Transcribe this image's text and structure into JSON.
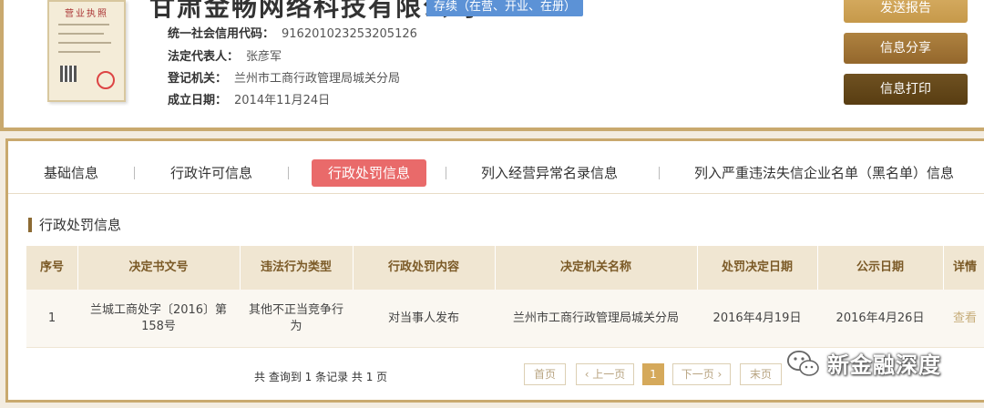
{
  "company": {
    "name": "甘肃金畅网络科技有限公司",
    "status": "存续（在营、开业、在册）",
    "license_title": "营业执照",
    "fields": [
      {
        "label": "统一社会信用代码：",
        "value": "916201023253205126"
      },
      {
        "label": "法定代表人：",
        "value": "张彦军"
      },
      {
        "label": "登记机关：",
        "value": "兰州市工商行政管理局城关分局"
      },
      {
        "label": "成立日期：",
        "value": "2014年11月24日"
      }
    ]
  },
  "actions": {
    "report": "发送报告",
    "share": "信息分享",
    "print": "信息打印"
  },
  "tabs": [
    {
      "label": "基础信息",
      "active": false
    },
    {
      "label": "行政许可信息",
      "active": false
    },
    {
      "label": "行政处罚信息",
      "active": true
    },
    {
      "label": "列入经营异常名录信息",
      "active": false
    },
    {
      "label": "列入严重违法失信企业名单（黑名单）信息",
      "active": false
    }
  ],
  "section": {
    "title": "行政处罚信息"
  },
  "table": {
    "headers": [
      "序号",
      "决定书文号",
      "违法行为类型",
      "行政处罚内容",
      "决定机关名称",
      "处罚决定日期",
      "公示日期",
      "详情"
    ],
    "rows": [
      [
        "1",
        "兰城工商处字〔2016〕第158号",
        "其他不正当竞争行为",
        "对当事人发布",
        "兰州市工商行政管理局城关分局",
        "2016年4月19日",
        "2016年4月26日",
        "查看"
      ]
    ]
  },
  "pagination": {
    "summary": "共 查询到 1 条记录 共 1 页",
    "first": "首页",
    "prev": "‹ 上一页",
    "current": "1",
    "next": "下一页 ›",
    "last": "末页"
  },
  "watermark": {
    "text": "新金融深度"
  },
  "colors": {
    "gold_border": "#c9a96e",
    "active_tab": "#e96a6a",
    "status_badge": "#5c92d6",
    "table_header_bg": "#f0e6d2",
    "btn_report": "#d0a458",
    "btn_share": "#a27636",
    "btn_print": "#634719"
  }
}
